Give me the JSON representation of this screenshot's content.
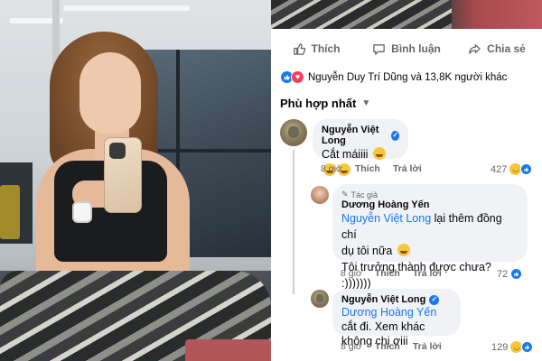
{
  "post": {
    "actions": {
      "like": "Thích",
      "comment": "Bình luận",
      "share": "Chia sẻ"
    },
    "reactions_summary": "Nguyễn Duy Trí Dũng và 13,8K người khác",
    "sort_label": "Phù hợp nhất"
  },
  "comments": [
    {
      "author": "Nguyễn Việt Long",
      "verified": true,
      "text": "Cắt máiiii",
      "emoji": [
        "grinning-face",
        "grinning-face",
        "grinning-face"
      ],
      "time": "8 giờ",
      "like_label": "Thích",
      "reply_label": "Trả lời",
      "reaction_count": "427",
      "reaction_icons": [
        "laugh-emoji",
        "like-emoji"
      ]
    },
    {
      "author_tag": "Tác giả",
      "author": "Dương Hoàng Yến",
      "mention": "Nguyễn Việt Long",
      "text_line1": " lại thêm đồng chí",
      "text_line2": "dụ tôi nữa",
      "text_line3": "Tôi trưởng thành được chưa? :)))))))",
      "time": "8 giờ",
      "like_label": "Thích",
      "reply_label": "Trả lời",
      "reaction_count": "72",
      "reaction_icons": [
        "like-emoji"
      ]
    },
    {
      "author": "Nguyễn Việt Long",
      "verified": true,
      "mention": "Dương Hoàng Yến",
      "text_line1": " cắt đi. Xem khác",
      "text_line2": "không chị ơiii",
      "time": "8 giờ",
      "like_label": "Thích",
      "reply_label": "Trả lời",
      "reaction_count": "129",
      "reaction_icons": [
        "laugh-emoji",
        "like-emoji"
      ]
    }
  ],
  "colors": {
    "link": "#1877f2",
    "secondary_text": "#65676b",
    "bubble": "#f0f2f5"
  }
}
